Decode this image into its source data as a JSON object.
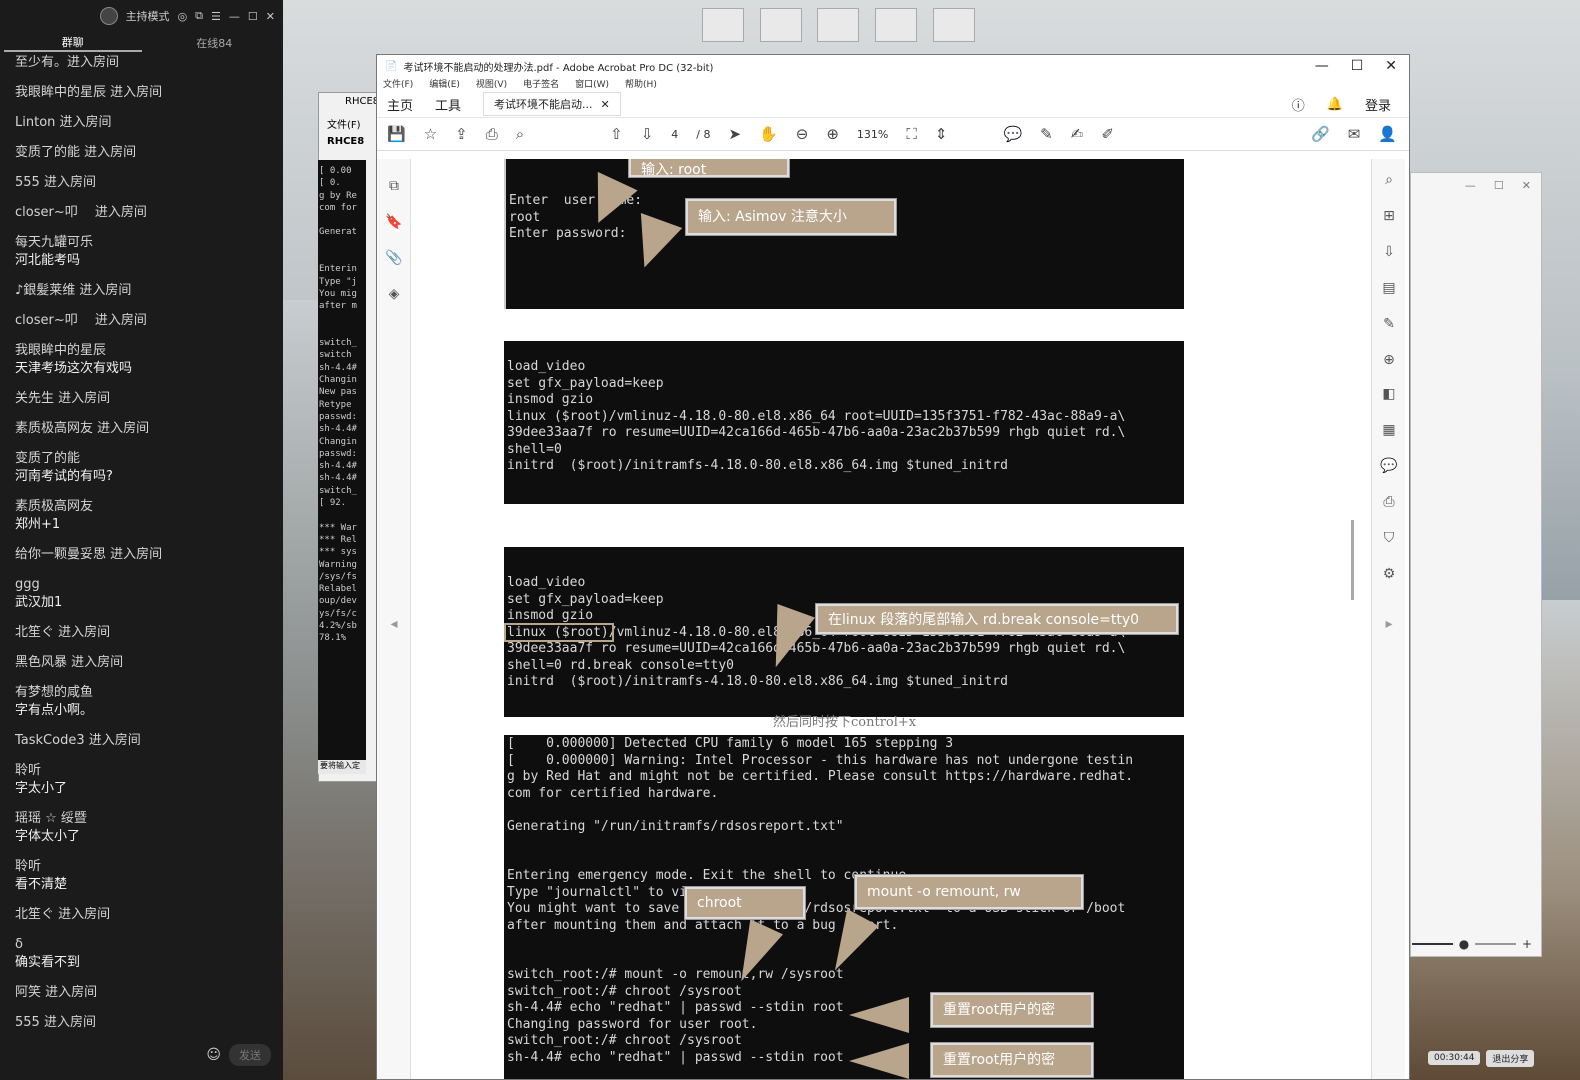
{
  "chat": {
    "host_mode": "主持模式",
    "tabs": [
      "群聊",
      "在线84"
    ],
    "messages": [
      {
        "user": "至少有。进入房间",
        "text": ""
      },
      {
        "user": "我眼眸中的星辰 进入房间",
        "text": ""
      },
      {
        "user": "Linton 进入房间",
        "text": ""
      },
      {
        "user": "变质了的能 进入房间",
        "text": ""
      },
      {
        "user": "555 进入房间",
        "text": ""
      },
      {
        "user": "closer~叩　 进入房间",
        "text": ""
      },
      {
        "user": "每天九罐可乐",
        "text": "河北能考吗"
      },
      {
        "user": "♪銀髪莱维 进入房间",
        "text": ""
      },
      {
        "user": "closer~叩　 进入房间",
        "text": ""
      },
      {
        "user": "我眼眸中的星辰",
        "text": "天津考场这次有戏吗"
      },
      {
        "user": "关先生 进入房间",
        "text": ""
      },
      {
        "user": "素质极高网友 进入房间",
        "text": ""
      },
      {
        "user": "变质了的能",
        "text": "河南考试的有吗?"
      },
      {
        "user": "素质极高网友",
        "text": "郑州+1"
      },
      {
        "user": "给你一颗曼妥思 进入房间",
        "text": ""
      },
      {
        "user": "ggg",
        "text": "武汉加1"
      },
      {
        "user": "北笙ぐ 进入房间",
        "text": ""
      },
      {
        "user": "黑色风暴 进入房间",
        "text": ""
      },
      {
        "user": "有梦想的咸鱼",
        "text": "字有点小啊。"
      },
      {
        "user": "TaskCode3 进入房间",
        "text": ""
      },
      {
        "user": "聆听",
        "text": "字太小了"
      },
      {
        "user": "瑶瑶 ☆ 绥暨",
        "text": "字体太小了"
      },
      {
        "user": "聆听",
        "text": "看不清楚"
      },
      {
        "user": "北笙ぐ 进入房间",
        "text": ""
      },
      {
        "user": "δ",
        "text": "确实看不到"
      },
      {
        "user": "阿笑 进入房间",
        "text": ""
      },
      {
        "user": "555 进入房间",
        "text": ""
      }
    ],
    "send_label": "发送"
  },
  "rhce": {
    "title": "RHCE8",
    "menu": "文件(F)",
    "tab": "RHCE8",
    "term_lines": [
      "[    0.00",
      "[    0.",
      "g by Re",
      "com for",
      "",
      "Generat",
      "",
      "",
      "Enterin",
      "Type \"j",
      "You mig",
      "after m",
      "",
      "",
      "switch_",
      "switch",
      "sh-4.4#",
      "Changin",
      "New pas",
      "Retype",
      "passwd:",
      "sh-4.4#",
      "Changin",
      "passwd:",
      "sh-4.4#",
      "sh-4.4#",
      "switch_",
      "[   92.",
      "",
      "*** War",
      "*** Rel",
      "*** sys",
      "Warning",
      "/sys/fs",
      "Relabel",
      "oup/dev",
      "ys/fs/c",
      "4.2%/sb",
      "78.1%"
    ],
    "status": "要将输入定"
  },
  "acrobat": {
    "title": "考试环境不能启动的处理办法.pdf - Adobe Acrobat Pro DC (32-bit)",
    "menu": [
      "文件(F)",
      "编辑(E)",
      "视图(V)",
      "电子签名",
      "窗口(W)",
      "帮助(H)"
    ],
    "tabs": {
      "home": "主页",
      "tools": "工具",
      "doc": "考试环境不能启动...",
      "login": "登录"
    },
    "page_current": "4",
    "page_total": "/ 8",
    "zoom": "131%",
    "term1": "Enter  user name:\nroot\nEnter password:",
    "callout1a": "输入:   root",
    "callout1b": "输入:   Asimov 注意大小",
    "term2": "load_video\nset gfx_payload=keep\ninsmod gzio\nlinux ($root)/vmlinuz-4.18.0-80.el8.x86_64 root=UUID=135f3751-f782-43ac-88a9-a\\\n39dee33aa7f ro resume=UUID=42ca166d-465b-47b6-aa0a-23ac2b37b599 rhgb quiet rd.\\\nshell=0\ninitrd  ($root)/initramfs-4.18.0-80.el8.x86_64.img $tuned_initrd",
    "term3": "load_video\nset gfx_payload=keep\ninsmod gzio\nlinux ($root)/vmlinuz-4.18.0-80.el8.x86_64 root=UUID=135f3751-f782-43ac-88a9-a\\\n39dee33aa7f ro resume=UUID=42ca166d-465b-47b6-aa0a-23ac2b37b599 rhgb quiet rd.\\\nshell=0 rd.break console=tty0\ninitrd  ($root)/initramfs-4.18.0-80.el8.x86_64.img $tuned_initrd",
    "callout3": "在linux 段落的尾部输入 rd.break console=tty0",
    "caption": "然后同时按下control+x",
    "term4": "[    0.000000] Detected CPU family 6 model 165 stepping 3\n[    0.000000] Warning: Intel Processor - this hardware has not undergone testin\ng by Red Hat and might not be certified. Please consult https://hardware.redhat.\ncom for certified hardware.\n\nGenerating \"/run/initramfs/rdsosreport.txt\"\n\n\nEntering emergency mode. Exit the shell to continue.\nType \"journalctl\" to view system logs.\nYou might want to save \"/run/initramfs/rdsosreport.txt\" to a USB stick or /boot\nafter mounting them and attach it to a bug report.\n\n\nswitch_root:/# mount -o remount,rw /sysroot\nswitch_root:/# chroot /sysroot\nsh-4.4# echo \"redhat\" | passwd --stdin root\nChanging password for user root.\nswitch_root:/# chroot /sysroot\nsh-4.4# echo \"redhat\" | passwd --stdin root",
    "callout4a": "chroot",
    "callout4b": "mount -o remount, rw",
    "callout4c": "重置root用户的密",
    "callout4d": "重置root用户的密"
  },
  "share": {
    "timer": "00:30:44",
    "exit": "退出分享"
  }
}
